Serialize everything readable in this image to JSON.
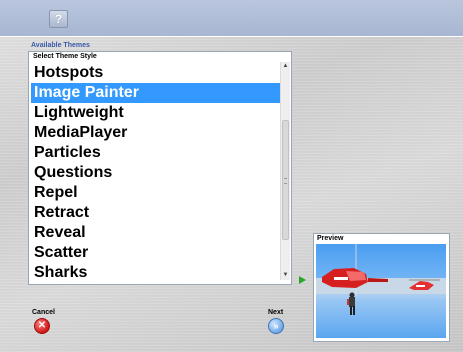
{
  "toolbar": {
    "help_icon": "?"
  },
  "themes": {
    "section_label": "Available Themes",
    "list_title": "Select Theme Style",
    "items": [
      {
        "label": "Hotspots",
        "selected": false
      },
      {
        "label": "Image Painter",
        "selected": true
      },
      {
        "label": "Lightweight",
        "selected": false
      },
      {
        "label": "MediaPlayer",
        "selected": false
      },
      {
        "label": "Particles",
        "selected": false
      },
      {
        "label": "Questions",
        "selected": false
      },
      {
        "label": "Repel",
        "selected": false
      },
      {
        "label": "Retract",
        "selected": false
      },
      {
        "label": "Reveal",
        "selected": false
      },
      {
        "label": "Scatter",
        "selected": false
      },
      {
        "label": "Sharks",
        "selected": false
      }
    ],
    "scroll_up": "▲",
    "scroll_down": "▼"
  },
  "preview": {
    "label": "Preview"
  },
  "footer": {
    "cancel_label": "Cancel",
    "cancel_glyph": "✕",
    "next_label": "Next",
    "next_glyph": "»"
  },
  "colors": {
    "selection": "#3399ff",
    "topbar": "#b1bfd8"
  }
}
